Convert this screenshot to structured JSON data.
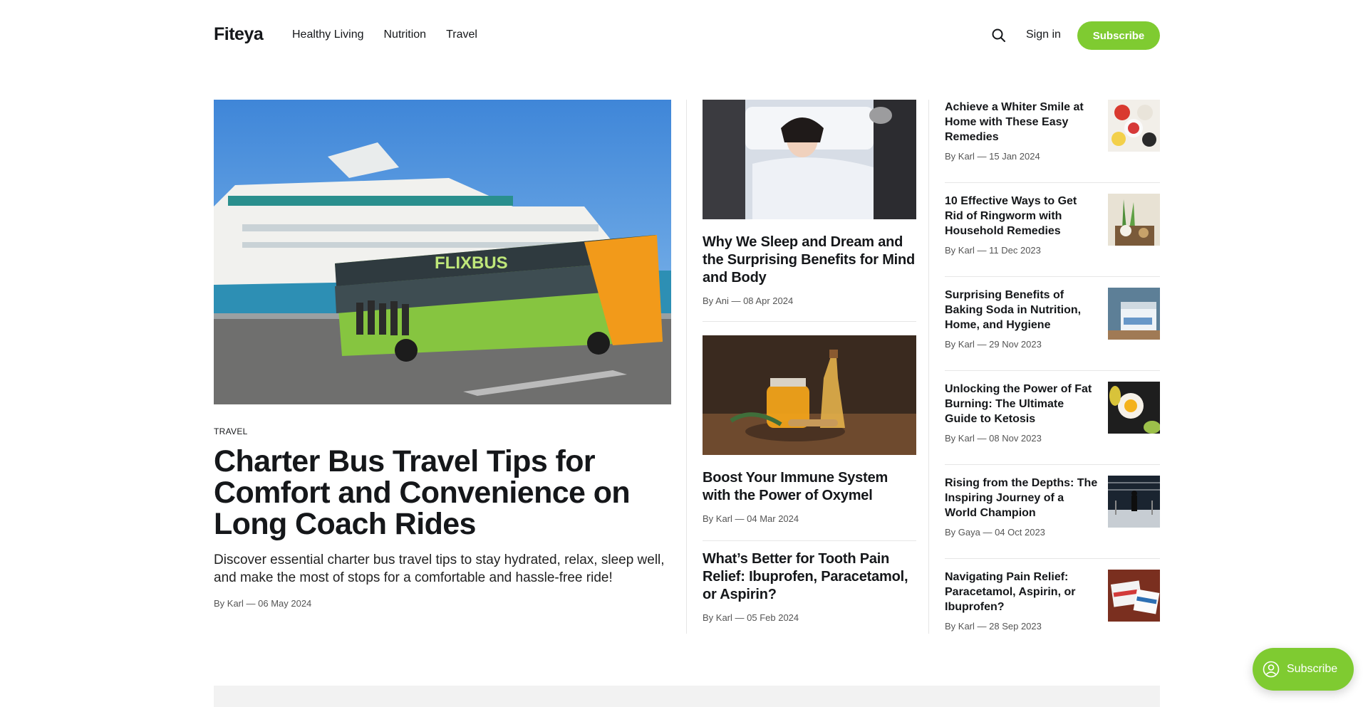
{
  "site": {
    "logo": "Fiteya",
    "nav": [
      "Healthy Living",
      "Nutrition",
      "Travel"
    ],
    "signin": "Sign in",
    "subscribe": "Subscribe"
  },
  "feature": {
    "tag": "TRAVEL",
    "title": "Charter Bus Travel Tips for Comfort and Convenience on Long Coach Rides",
    "excerpt": "Discover essential charter bus travel tips to stay hydrated, relax, sleep well, and make the most of stops for a comfortable and hassle-free ride!",
    "meta": "By Karl — 06 May 2024",
    "image": "bus-and-cruise-ship-photo",
    "bus_text": "FLIXBUS"
  },
  "mid_posts": [
    {
      "title": "Why We Sleep and Dream and the Surprising Benefits for Mind and Body",
      "meta": "By Ani — 08 Apr 2024",
      "image": "sleeping-woman-photo"
    },
    {
      "title": "Boost Your Immune System with the Power of Oxymel",
      "meta": "By Karl — 04 Mar 2024",
      "image": "honey-jar-photo"
    },
    {
      "title": "What’s Better for Tooth Pain Relief: Ibuprofen, Paracetamol, or Aspirin?",
      "meta": "By Karl — 05 Feb 2024"
    }
  ],
  "side_posts": [
    {
      "title": "Achieve a Whiter Smile at Home with These Easy Remedies",
      "meta": "By Karl — 15 Jan 2024",
      "image": "fruit-bowls-thumb"
    },
    {
      "title": "10 Effective Ways to Get Rid of Ringworm with Household Remedies",
      "meta": "By Karl — 11 Dec 2023",
      "image": "herbal-remedies-thumb"
    },
    {
      "title": "Surprising Benefits of Baking Soda in Nutrition, Home, and Hygiene",
      "meta": "By Karl — 29 Nov 2023",
      "image": "baking-soda-jar-thumb"
    },
    {
      "title": "Unlocking the Power of Fat Burning: The Ultimate Guide to Ketosis",
      "meta": "By Karl — 08 Nov 2023",
      "image": "egg-avocado-thumb"
    },
    {
      "title": "Rising from the Depths: The Inspiring Journey of a World Champion",
      "meta": "By Gaya — 04 Oct 2023",
      "image": "boxing-ring-thumb"
    },
    {
      "title": "Navigating Pain Relief: Paracetamol, Aspirin, or Ibuprofen?",
      "meta": "By Karl — 28 Sep 2023",
      "image": "medicine-boxes-thumb"
    }
  ],
  "portal": {
    "label": "Subscribe"
  },
  "colors": {
    "accent": "#7fcb31",
    "text": "#15171a",
    "muted": "#555555",
    "divider": "#e6e6e6"
  }
}
